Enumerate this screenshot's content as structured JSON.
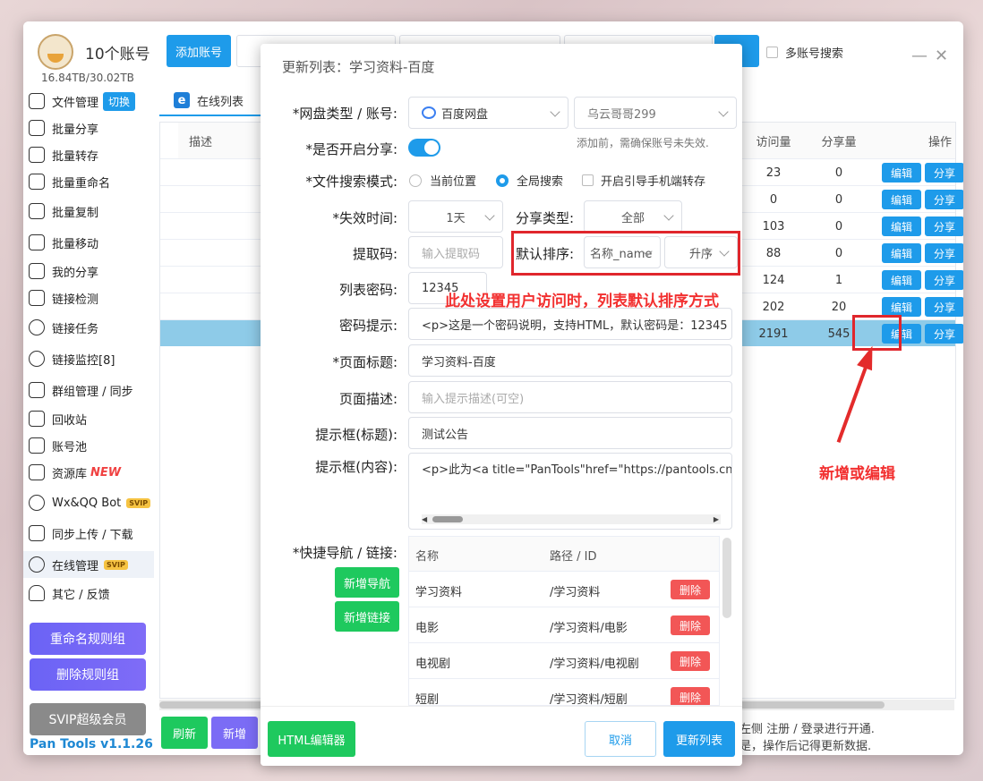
{
  "app": {
    "account_count": "10个账号",
    "storage": "16.84TB/30.02TB",
    "version": "Pan Tools v1.1.26",
    "svip_button": "SVIP超级会员"
  },
  "sidebar": {
    "items": [
      {
        "label": "文件管理",
        "badge": "切换"
      },
      {
        "label": "批量分享"
      },
      {
        "label": "批量转存"
      },
      {
        "label": "批量重命名"
      },
      {
        "label": "批量复制"
      },
      {
        "label": "批量移动"
      },
      {
        "label": "我的分享"
      },
      {
        "label": "链接检测"
      },
      {
        "label": "链接任务"
      },
      {
        "label": "链接监控[8]"
      },
      {
        "label": "群组管理 / 同步"
      },
      {
        "label": "回收站"
      },
      {
        "label": "账号池"
      },
      {
        "label": "资源库",
        "new": "NEW"
      },
      {
        "label": "Wx&QQ Bot",
        "svip": "SVIP"
      },
      {
        "label": "同步上传 / 下载"
      },
      {
        "label": "在线管理",
        "svip": "SVIP"
      },
      {
        "label": "其它 / 反馈"
      }
    ],
    "rename_rules": "重命名规则组",
    "delete_rules": "删除规则组"
  },
  "toolbar": {
    "add_account": "添加账号",
    "multi_search": "多账号搜索",
    "search_partial": "索"
  },
  "tabs": [
    {
      "label": "在线列表"
    }
  ],
  "table": {
    "headers": [
      "描述",
      "访问量",
      "分享量",
      "操作"
    ],
    "rows": [
      {
        "visits": "23",
        "shares": "0"
      },
      {
        "visits": "0",
        "shares": "0"
      },
      {
        "visits": "103",
        "shares": "0"
      },
      {
        "visits": "88",
        "shares": "0"
      },
      {
        "visits": "124",
        "shares": "1"
      },
      {
        "visits": "202",
        "shares": "20"
      },
      {
        "visits": "2191",
        "shares": "545"
      }
    ],
    "edit_label": "编辑",
    "share_label": "分享"
  },
  "bottom": {
    "refresh": "刷新",
    "add": "新增",
    "note1": "左侧 注册 / 登录进行开通.",
    "note2": "是，操作后记得更新数据."
  },
  "dialog": {
    "title": "更新列表：学习资料-百度",
    "fields": {
      "disk_type_label": "*网盘类型 / 账号:",
      "disk_type_value": "百度网盘",
      "account_value": "乌云哥哥299",
      "share_label": "*是否开启分享:",
      "share_hint": "添加前，需确保账号未失效.",
      "search_mode_label": "*文件搜索模式:",
      "search_mode_current": "当前位置",
      "search_mode_global": "全局搜索",
      "mobile_transfer": "开启引导手机端转存",
      "expire_label": "*失效时间:",
      "expire_value": "1天",
      "share_type_label": "分享类型:",
      "share_type_value": "全部",
      "code_label": "提取码:",
      "code_placeholder": "输入提取码",
      "sort_label": "默认排序:",
      "sort_field": "名称_name",
      "sort_order": "升序",
      "list_pwd_label": "列表密码:",
      "list_pwd_value": "12345",
      "pwd_hint_label": "密码提示:",
      "pwd_hint_value": "<p>这是一个密码说明，支持HTML，默认密码是：12345",
      "page_title_label": "*页面标题:",
      "page_title_value": "学习资料-百度",
      "page_desc_label": "页面描述:",
      "page_desc_placeholder": "输入提示描述(可空)",
      "tip_title_label": "提示框(标题):",
      "tip_title_value": "测试公告",
      "tip_content_label": "提示框(内容):",
      "tip_content_value": "<p>此为<a title=\"PanTools\"href=\"https://pantools.cn",
      "nav_label": "*快捷导航 / 链接:",
      "add_nav": "新增导航",
      "add_link": "新增链接"
    },
    "nav_table": {
      "headers": [
        "名称",
        "路径 / ID"
      ],
      "rows": [
        {
          "name": "学习资料",
          "path": "/学习资料"
        },
        {
          "name": "电影",
          "path": "/学习资料/电影"
        },
        {
          "name": "电视剧",
          "path": "/学习资料/电视剧"
        },
        {
          "name": "短剧",
          "path": "/学习资料/短剧"
        }
      ],
      "delete_label": "删除"
    },
    "footer": {
      "html_editor": "HTML编辑器",
      "cancel": "取消",
      "update": "更新列表"
    }
  },
  "annotations": {
    "sort_note": "此处设置用户访问时，列表默认排序方式",
    "edit_note": "新增或编辑"
  },
  "colors": {
    "primary": "#1e9bea",
    "green": "#1ec95e",
    "danger": "#f25656",
    "annotation_red": "#e0262c"
  }
}
